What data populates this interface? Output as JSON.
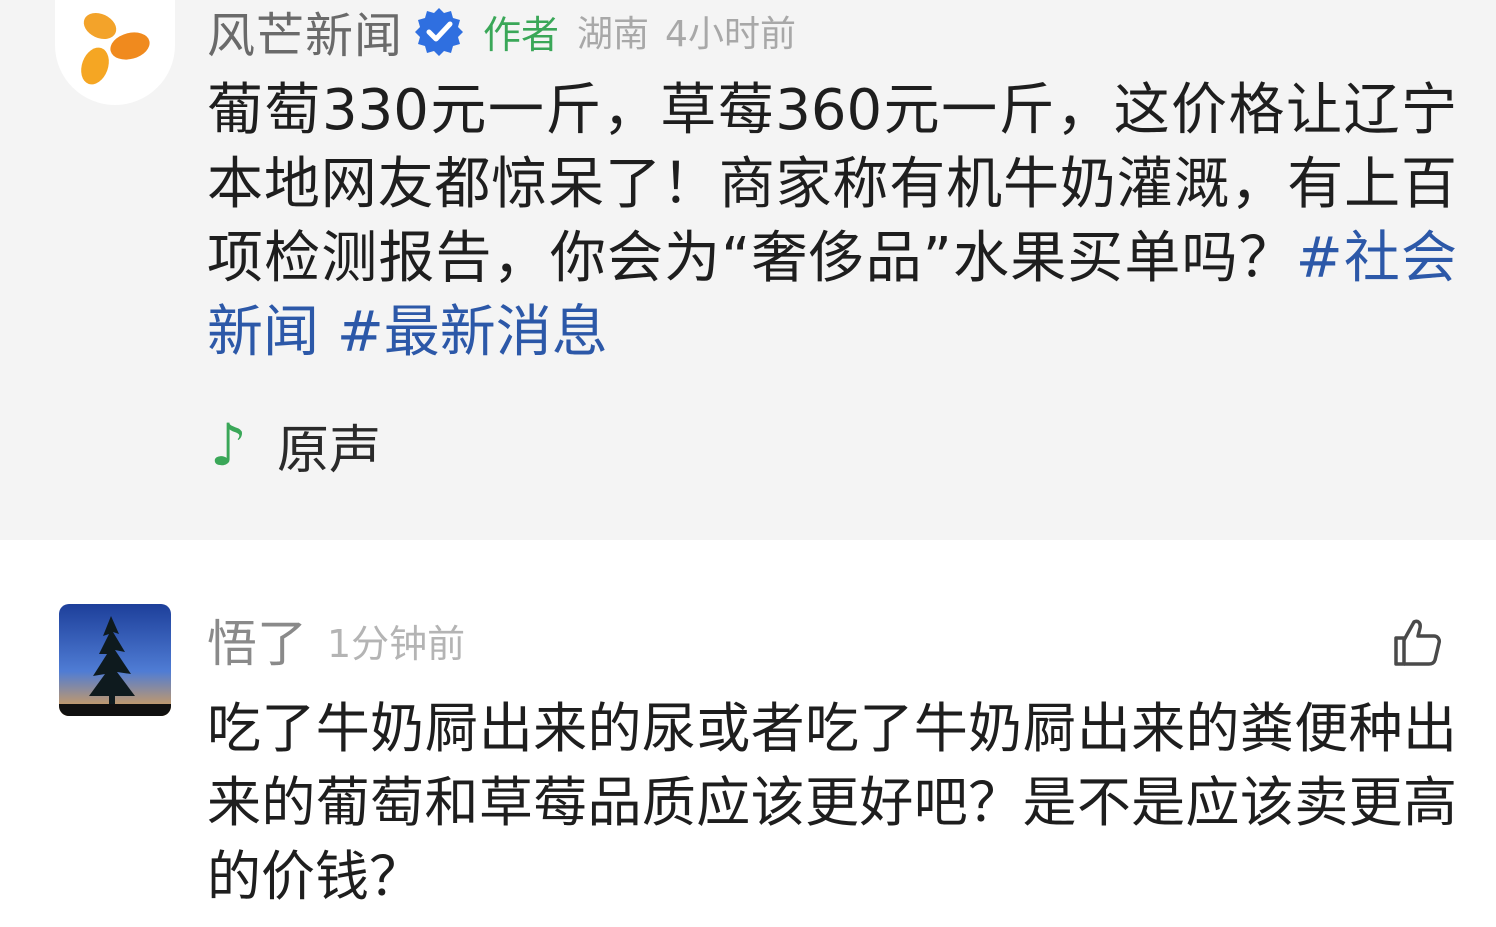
{
  "post": {
    "author": "风芒新闻",
    "author_tag": "作者",
    "location": "湖南",
    "time": "4小时前",
    "text": "葡萄330元一斤，草莓360元一斤，这价格让辽宁本地网友都惊呆了！商家称有机牛奶灌溉，有上百项检测报告，你会为“奢侈品”水果买单吗？",
    "hashtags": [
      "#社会新闻",
      "#最新消息"
    ],
    "audio_label": "原声"
  },
  "comment": {
    "user": "悟了",
    "time": "1分钟前",
    "text": "吃了牛奶屙出来的尿或者吃了牛奶屙出来的粪便种出来的葡萄和草莓品质应该更好吧？是不是应该卖更高的价钱？"
  },
  "colors": {
    "accent_green": "#3aa758",
    "hashtag_blue": "#2c58a8",
    "verified_blue": "#2f6fe0",
    "logo_orange": "#f3a32a"
  },
  "icons": {
    "verified": "verified-badge-icon",
    "audio": "music-note-icon",
    "like": "thumbs-up-icon"
  }
}
